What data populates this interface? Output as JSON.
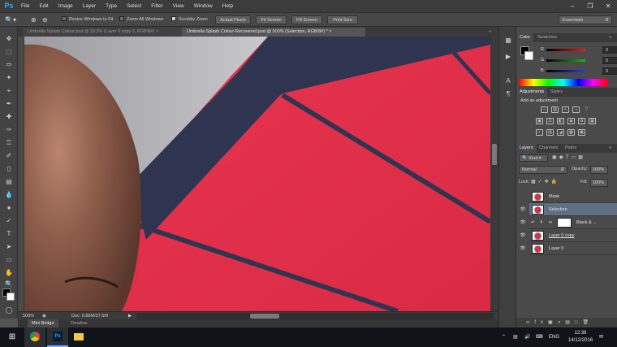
{
  "app": {
    "logo": "Ps",
    "menu": [
      "File",
      "Edit",
      "Image",
      "Layer",
      "Type",
      "Select",
      "Filter",
      "View",
      "Window",
      "Help"
    ],
    "window_controls": [
      "–",
      "❐",
      "✕"
    ]
  },
  "options_bar": {
    "resize_windows_label": "Resize Windows to Fit",
    "zoom_all_windows_label": "Zoom All Windows",
    "scrubby_zoom_label": "Scrubby Zoom",
    "scrubby_checked": true,
    "actual_pixels": "Actual Pixels",
    "fit_screen": "Fit Screen",
    "fill_screen": "Fill Screen",
    "print_size": "Print Size",
    "workspace": "Essentials"
  },
  "document_tabs": [
    {
      "label": "Umbrella Splash Colour.psd @ 33.3% (Layer 0 copy 3, RGB/8#)",
      "active": false
    },
    {
      "label": "Umbrella Splash Colour-Recovered.psd @ 500% (Selection, RGB/8#) *",
      "active": true
    }
  ],
  "status_bar": {
    "zoom": "500%",
    "doc": "Doc: 6.88M/27.5M"
  },
  "mini_bridge": {
    "tabs": [
      "Mini Bridge",
      "Timeline"
    ]
  },
  "color_panel": {
    "tabs": [
      "Color",
      "Swatches"
    ],
    "channels": [
      {
        "label": "R",
        "value": "0"
      },
      {
        "label": "G",
        "value": "0"
      },
      {
        "label": "B",
        "value": "0"
      }
    ],
    "colors": {
      "red": "#e02020",
      "green": "#20b020",
      "blue": "#2040e0"
    }
  },
  "adjustments_panel": {
    "tabs": [
      "Adjustments",
      "Styles"
    ],
    "heading": "Add an adjustment"
  },
  "layers_panel": {
    "tabs": [
      "Layers",
      "Channels",
      "Paths"
    ],
    "kind_filter": "Kind",
    "blend_mode": "Normal",
    "opacity_label": "Opacity:",
    "opacity_value": "100%",
    "lock_label": "Lock:",
    "fill_label": "Fill:",
    "fill_value": "100%",
    "layers": [
      {
        "name": "Mask",
        "visible": false,
        "selected": false
      },
      {
        "name": "Selection",
        "visible": true,
        "selected": true
      },
      {
        "name": "Black & ...",
        "visible": true,
        "selected": false
      },
      {
        "name": "Layer 0 copy",
        "visible": true,
        "selected": false
      },
      {
        "name": "Layer 0",
        "visible": true,
        "selected": false
      }
    ]
  },
  "taskbar": {
    "language": "ENG",
    "time": "12:36",
    "date": "14/12/2016"
  },
  "colors": {
    "canvas_red": "#e42d48",
    "umbrella_rib": "#33384f",
    "panel_bg": "#4a4a4a",
    "selection_highlight": "#5f6e80"
  }
}
